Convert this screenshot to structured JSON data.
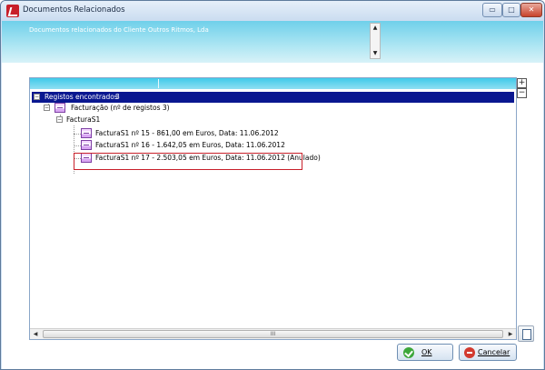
{
  "window": {
    "title": "Documentos Relacionados",
    "minimize_glyph": "▭",
    "maximize_glyph": "□",
    "close_glyph": "✕"
  },
  "header": {
    "text": "Documentos relacionados do Cliente Outros Ritmos, Lda",
    "scroll_up_glyph": "▲",
    "scroll_down_glyph": "▼"
  },
  "tree": {
    "root": {
      "label": "Registos encontrados",
      "count": "3",
      "expander": "−"
    },
    "group": {
      "label": "Facturação (nº de registos 3)",
      "expander": "−"
    },
    "series": {
      "label": "FacturaS1",
      "expander": "−"
    },
    "documents": [
      {
        "label": "FacturaS1 nº 15 - 861,00 em Euros, Data: 11.06.2012"
      },
      {
        "label": "FacturaS1 nº 16 - 1.642,05 em Euros, Data: 11.06.2012"
      },
      {
        "label": "FacturaS1 nº 17 - 2.503,05 em Euros, Data: 11.06.2012 (Anulado)"
      }
    ]
  },
  "side_buttons": {
    "expand_glyph": "+",
    "collapse_glyph": "−"
  },
  "hscroll": {
    "left_glyph": "◀",
    "right_glyph": "▶",
    "thumb_grip": "III"
  },
  "buttons": {
    "ok_label": "OK",
    "cancel_label": "Cancelar"
  },
  "colors": {
    "selection": "#0a1790",
    "highlight_border": "#c8202a",
    "header_band": "#3fcaea"
  }
}
